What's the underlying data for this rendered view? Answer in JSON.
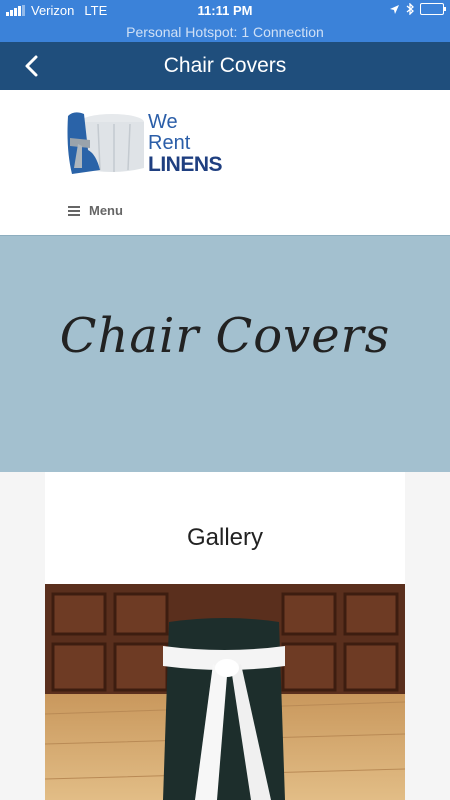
{
  "status_bar": {
    "carrier": "Verizon",
    "network": "LTE",
    "time": "11:11 PM",
    "hotspot": "Personal Hotspot: 1 Connection",
    "color": "#3b82d9"
  },
  "nav_bar": {
    "title": "Chair Covers",
    "back_icon": "chevron-left-icon",
    "color": "#1f4e7c"
  },
  "site": {
    "logo": {
      "line1": "We",
      "line2": "Rent",
      "line3": "LINENS"
    },
    "menu_label": "Menu"
  },
  "hero": {
    "title": "Chair Covers",
    "color": "#a3c0cf"
  },
  "gallery": {
    "title": "Gallery"
  }
}
